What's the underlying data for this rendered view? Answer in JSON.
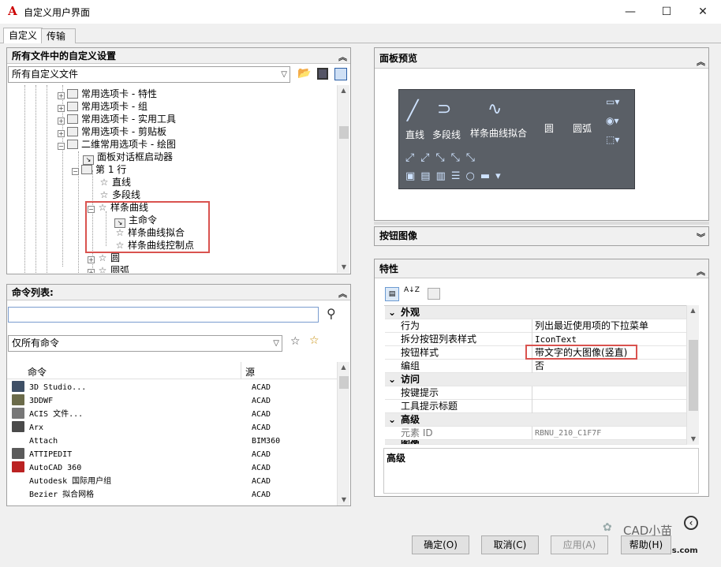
{
  "window": {
    "title": "自定义用户界面",
    "minimize": "—",
    "maximize": "☐",
    "close": "✕",
    "app_icon": "A"
  },
  "tabs": [
    {
      "label": "自定义"
    },
    {
      "label": "传输"
    }
  ],
  "customizations_panel": {
    "title": "所有文件中的自定义设置",
    "file_combo": "所有自定义文件",
    "tree": [
      {
        "label": "常用选项卡 - 特性"
      },
      {
        "label": "常用选项卡 - 组"
      },
      {
        "label": "常用选项卡 - 实用工具"
      },
      {
        "label": "常用选项卡 - 剪贴板"
      },
      {
        "label": "二维常用选项卡 - 绘图"
      },
      {
        "label": "面板对话框启动器"
      },
      {
        "label": "第 1 行"
      },
      {
        "label": "直线"
      },
      {
        "label": "多段线"
      },
      {
        "label": "样条曲线"
      },
      {
        "label": "主命令"
      },
      {
        "label": "样条曲线拟合"
      },
      {
        "label": "样条曲线控制点"
      },
      {
        "label": "圆"
      },
      {
        "label": "圆弧"
      }
    ]
  },
  "command_list": {
    "title": "命令列表:",
    "search_value": "",
    "filter_combo": "仅所有命令",
    "col_command": "命令",
    "col_source": "源",
    "rows": [
      {
        "name": "3D Studio...",
        "source": "ACAD"
      },
      {
        "name": "3DDWF",
        "source": "ACAD"
      },
      {
        "name": "ACIS 文件...",
        "source": "ACAD"
      },
      {
        "name": "Arx",
        "source": "ACAD"
      },
      {
        "name": "Attach",
        "source": "BIM360"
      },
      {
        "name": "ATTIPEDIT",
        "source": "ACAD"
      },
      {
        "name": "AutoCAD 360",
        "source": "ACAD"
      },
      {
        "name": "Autodesk 国际用户组",
        "source": "ACAD"
      },
      {
        "name": "Bezier 拟合网格",
        "source": "ACAD"
      }
    ]
  },
  "preview_panel": {
    "title": "面板预览",
    "labels": {
      "line": "直线",
      "polyline": "多段线",
      "spline_fit": "样条曲线拟合",
      "circle": "圆",
      "arc": "圆弧"
    }
  },
  "button_image_panel": {
    "title": "按钮图像"
  },
  "properties_panel": {
    "title": "特性",
    "sort_icon": "A↓Z",
    "categories": [
      {
        "label": "外观",
        "rows": [
          {
            "name": "行为",
            "value": "列出最近使用项的下拉菜单"
          },
          {
            "name": "拆分按钮列表样式",
            "value": "IconText"
          },
          {
            "name": "按钮样式",
            "value": "带文字的大图像(竖直)"
          },
          {
            "name": "编组",
            "value": "否"
          }
        ]
      },
      {
        "label": "访问",
        "rows": [
          {
            "name": "按键提示",
            "value": ""
          },
          {
            "name": "工具提示标题",
            "value": ""
          }
        ]
      },
      {
        "label": "高级",
        "rows": [
          {
            "name": "元素 ID",
            "value": "RBNU_210_C1F7F"
          }
        ]
      },
      {
        "label": "图像",
        "rows": []
      }
    ],
    "description_title": "高级"
  },
  "footer": {
    "ok": "确定(O)",
    "cancel": "取消(C)",
    "apply": "应用(A)",
    "help": "帮助(H)"
  },
  "watermark": {
    "wechat": "CAD小苗",
    "site": "coyis.com"
  },
  "colors": {
    "highlight_red": "#d9534f",
    "preview_bg": "#5a5f66"
  }
}
